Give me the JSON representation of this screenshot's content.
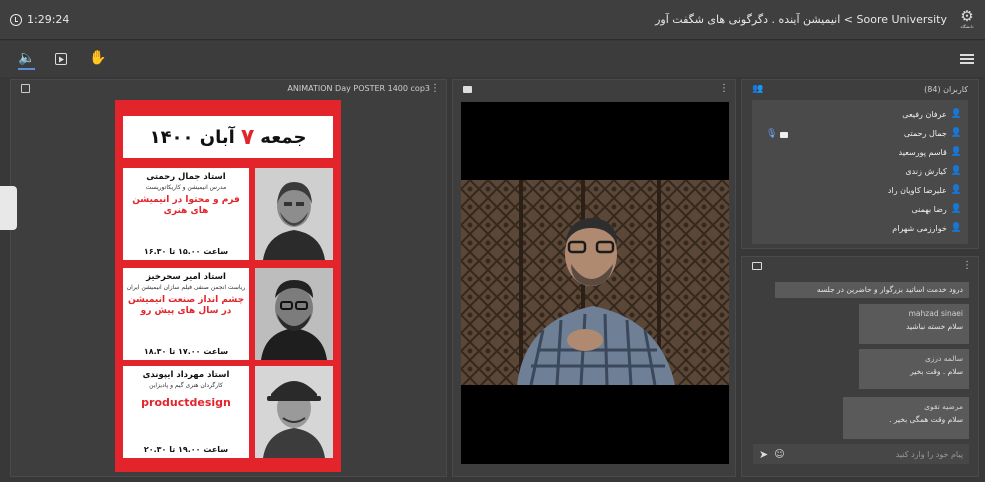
{
  "header": {
    "timer": "1:29:24",
    "title": "Soore University > انیمیشن آینده . دگرگونی های شگفت آور",
    "logo_caption": "دانشگاه"
  },
  "toolbar": {
    "icons": [
      "speaker-icon",
      "screen-share-icon",
      "raise-hand-icon",
      "menu-icon"
    ]
  },
  "presentation": {
    "title": "ANIMATION Day POSTER 1400 cop3",
    "poster": {
      "day": "جمعه",
      "day_number": "۷",
      "month_year": "آبان ۱۴۰۰",
      "speakers": [
        {
          "name": "استاد جمال رحمتی",
          "role": "مدرس انیمیشن و کاریکاتوریست",
          "topic": "فرم و محتوا در انیمیشن های هنری",
          "time": "ساعت ۱۵.۰۰ تا ۱۶.۳۰"
        },
        {
          "name": "استاد امیر سحرخیز",
          "role": "ریاست انجمن صنفی فیلم سازان انیمیشن ایران",
          "topic": "چشم انداز صنعت انیمیشن در سال های پیش رو",
          "time": "ساعت ۱۷.۰۰ تا ۱۸.۳۰"
        },
        {
          "name": "استاد مهرداد ایپوندی",
          "role": "کارگردان هنری گیم و پادیزاین",
          "topic": "productdesign",
          "time": "ساعت ۱۹.۰۰ تا ۲۰.۳۰"
        }
      ]
    }
  },
  "users": {
    "title": "کاربران (84)",
    "list": [
      {
        "name": "عرفان رفیعی",
        "color": "#e05a4a"
      },
      {
        "name": "جمال رحمتی",
        "color": "#6aa8ff"
      },
      {
        "name": "قاسم پورسعید",
        "color": "#6aa8ff"
      },
      {
        "name": "کیارش زندی",
        "color": "#6aa8ff"
      },
      {
        "name": "علیرضا کاویان راد",
        "color": "#6aa8ff"
      },
      {
        "name": "رضا بهمنی",
        "color": "#6aa8ff"
      },
      {
        "name": "خوارزمی شهرام",
        "color": "#7cd36a"
      }
    ]
  },
  "chat": {
    "messages": [
      {
        "sender": "",
        "text": "درود خدمت اساتید بزرگوار و حاضرین در جلسه"
      },
      {
        "sender": "mahzad sinaei",
        "text": "سلام خسته نباشید"
      },
      {
        "sender": "سالمه درزی",
        "text": "سلام . وقت بخیر"
      },
      {
        "sender": "مرضیه تقوی",
        "text": "سلام وقت همگی بخیر ."
      }
    ],
    "input_placeholder": "پیام خود را وارد کنید"
  }
}
